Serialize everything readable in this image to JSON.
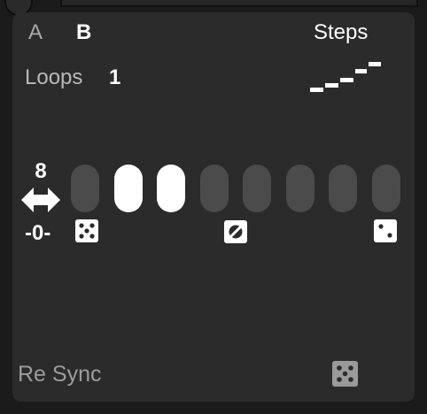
{
  "tabs": {
    "a_label": "A",
    "b_label": "B"
  },
  "steps_mode": {
    "label": "Steps",
    "icon": "staircase-icon"
  },
  "loops": {
    "label": "Loops",
    "value": "1"
  },
  "sequence": {
    "length": "8",
    "offset": "-0-",
    "steps": [
      false,
      true,
      true,
      false,
      false,
      false,
      false,
      false
    ]
  },
  "footer": {
    "resync_label": "Re Sync"
  },
  "colors": {
    "panel": "#2b2b2b",
    "step_on": "#ffffff",
    "step_off": "#4b4b4b",
    "text_primary": "#ffffff",
    "text_muted": "#a9a9a9"
  },
  "icons": [
    "double-arrow-icon",
    "dice-five-icon",
    "null-icon",
    "dice-two-icon"
  ]
}
